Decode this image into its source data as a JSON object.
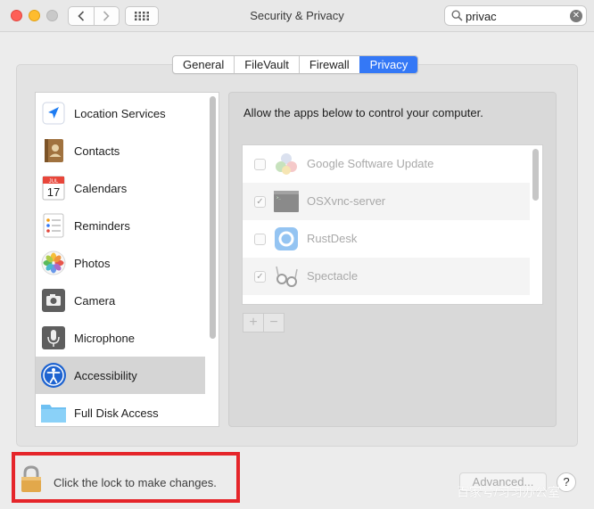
{
  "window": {
    "title": "Security & Privacy",
    "back_icon": "chevron-left-icon",
    "forward_icon": "chevron-right-icon",
    "grid_icon": "show-all-grid-icon",
    "traffic_lights": {
      "close": "#fe5f57",
      "minimize": "#febc2e",
      "zoom": "#c9c9c9"
    }
  },
  "search": {
    "value": "privac",
    "icon": "search-icon",
    "clear_icon": "clear-icon"
  },
  "tabs": [
    {
      "label": "General",
      "active": false
    },
    {
      "label": "FileVault",
      "active": false
    },
    {
      "label": "Firewall",
      "active": false
    },
    {
      "label": "Privacy",
      "active": true
    }
  ],
  "categories": [
    {
      "label": "Location Services",
      "icon": "location-arrow-icon",
      "selected": false
    },
    {
      "label": "Contacts",
      "icon": "contacts-book-icon",
      "selected": false
    },
    {
      "label": "Calendars",
      "icon": "calendar-icon",
      "selected": false,
      "icon_text": {
        "month": "JUL",
        "day": "17"
      }
    },
    {
      "label": "Reminders",
      "icon": "reminders-list-icon",
      "selected": false
    },
    {
      "label": "Photos",
      "icon": "photos-flower-icon",
      "selected": false
    },
    {
      "label": "Camera",
      "icon": "camera-icon",
      "selected": false
    },
    {
      "label": "Microphone",
      "icon": "microphone-icon",
      "selected": false
    },
    {
      "label": "Accessibility",
      "icon": "accessibility-icon",
      "selected": true
    },
    {
      "label": "Full Disk Access",
      "icon": "folder-icon",
      "selected": false
    }
  ],
  "detail": {
    "description": "Allow the apps below to control your computer.",
    "apps": [
      {
        "name": "Google Software Update",
        "checked": false,
        "icon": "google-update-icon"
      },
      {
        "name": "OSXvnc-server",
        "checked": true,
        "icon": "terminal-app-icon"
      },
      {
        "name": "RustDesk",
        "checked": false,
        "icon": "rustdesk-icon"
      },
      {
        "name": "Spectacle",
        "checked": true,
        "icon": "spectacle-glasses-icon"
      }
    ],
    "add_label": "+",
    "remove_label": "−"
  },
  "footer": {
    "lock_text": "Click the lock to make changes.",
    "lock_icon": "padlock-icon",
    "advanced_label": "Advanced...",
    "help_label": "?",
    "watermark": "百家号/习习办公室"
  },
  "colors": {
    "accent": "#3478f6",
    "highlight_border": "#e5252a",
    "selected_row": "#d5d5d5"
  }
}
